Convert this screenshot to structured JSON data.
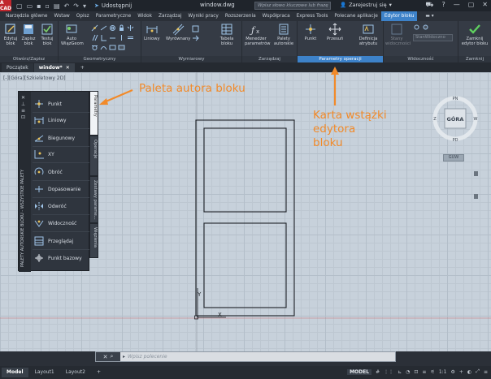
{
  "app": {
    "logo": "A CAD",
    "share_label": "Udostępnij",
    "doc_title": "window.dwg",
    "search_placeholder": "Wpisz słowo kluczowe lub frazę",
    "sign_in": "Zarejestruj się"
  },
  "menu_tabs": [
    "Narzędzia główne",
    "Wstaw",
    "Opisz",
    "Parametryczne",
    "Widok",
    "Zarządzaj",
    "Wyniki pracy",
    "Rozszerzenia",
    "Współpraca",
    "Express Tools",
    "Polecane aplikacje",
    "Edytor bloku"
  ],
  "ribbon": {
    "panels": {
      "open_save": "Otwórz/Zapisz",
      "geometric": "Geometryczny",
      "dimensional": "Wymiarowy",
      "manage": "Zarządzaj",
      "param_ops": "Parametry operacji",
      "visibility": "Widoczność",
      "close": "Zamknij"
    },
    "buttons": {
      "edit_block": "Edytuj blok",
      "save_block": "Zapisz blok",
      "test_block": "Testuj blok",
      "auto_constrain": "Auto WiązGeom",
      "linear": "Liniowy",
      "aligned": "Wyrównany",
      "block_table": "Tabela bloku",
      "param_manager": "Menedżer parametrów",
      "authoring_palettes": "Palety autorskie",
      "point": "Punkt",
      "move": "Przesuń",
      "attr_def": "Definicja atrybutu",
      "visibility_states": "Stany widoczności",
      "close_editor": "Zamknij edytor bloku"
    },
    "visibility_dropdown": "StanWidoczno"
  },
  "file_tabs": [
    "Początek",
    "window*"
  ],
  "canvas_label": "[-][Góra][Szkieletowy 2D]",
  "palette": {
    "title": "PALETY AUTORSKIE BLOKU - WSZYSTKIE PALETY",
    "tools": [
      "Punkt",
      "Liniowy",
      "Biegunowy",
      "XY",
      "Obróć",
      "Dopasowanie",
      "Odwróć",
      "Widoczność",
      "Przeglądaj",
      "Punkt bazowy"
    ],
    "tabs": [
      "Parametry",
      "Operacje",
      "Zestawy parame...",
      "Więzienia"
    ]
  },
  "annotations": {
    "palette": "Paleta autora bloku",
    "ribbon": [
      "Karta wstążki",
      "edytora",
      "bloku"
    ]
  },
  "viewcube": {
    "n": "PN",
    "s": "PD",
    "w": "Z",
    "e": "W",
    "face": "GÓRA",
    "wcs": "GUW"
  },
  "command": {
    "placeholder": "Wpisz polecenie"
  },
  "status": {
    "layouts": [
      "Model",
      "Layout1",
      "Layout2"
    ],
    "model_label": "MODEL",
    "scale": "1:1"
  }
}
